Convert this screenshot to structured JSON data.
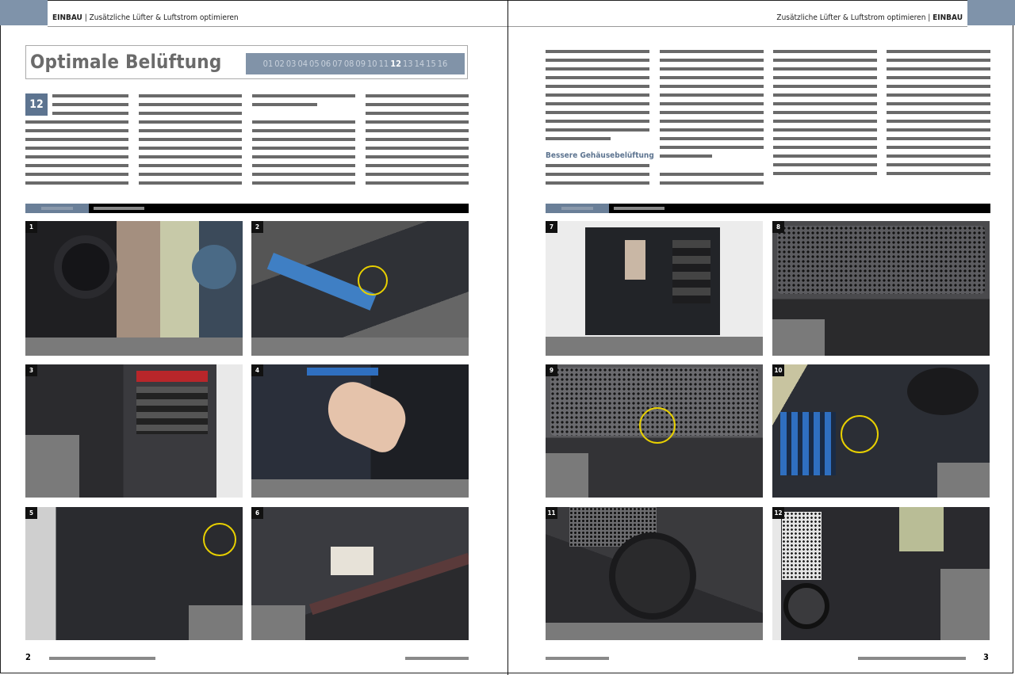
{
  "header": {
    "left_section": "EINBAU",
    "left_title": "Zusätzliche Lüfter & Luftstrom optimieren",
    "right_title": "Zusätzliche Lüfter & Luftstrom optimieren",
    "right_section": "EINBAU"
  },
  "title": "Optimale Belüftung",
  "pager": {
    "pages": [
      "01",
      "02",
      "03",
      "04",
      "05",
      "06",
      "07",
      "08",
      "09",
      "10",
      "11",
      "12",
      "13",
      "14",
      "15",
      "16"
    ],
    "current": "12"
  },
  "step_number": "12",
  "subheading": "Bessere Gehäusebelüftung",
  "photos": [
    "1",
    "2",
    "3",
    "4",
    "5",
    "6",
    "7",
    "8",
    "9",
    "10",
    "11",
    "12"
  ],
  "footer": {
    "left_page": "2",
    "right_page": "3"
  },
  "colors": {
    "accent": "#5d7490",
    "pager_bg": "#8193a8",
    "highlight": "#e8d000"
  }
}
